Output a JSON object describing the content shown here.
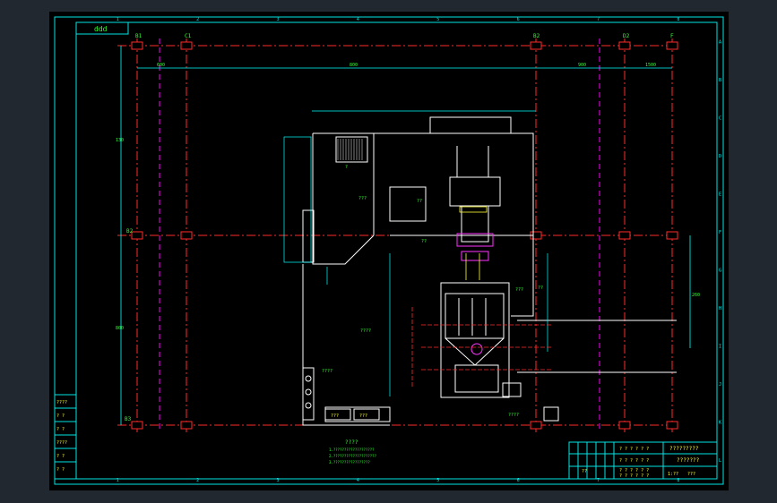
{
  "drawing": {
    "top_tag": "ddd",
    "column_markers": [
      "1",
      "2",
      "3",
      "4",
      "5",
      "6",
      "7",
      "8"
    ],
    "row_markers": [
      "A",
      "B",
      "C",
      "D",
      "E",
      "F",
      "G",
      "H",
      "I",
      "J",
      "K",
      "L"
    ],
    "axis_labels_top": [
      "B1",
      "C1",
      "B2",
      "D2",
      "F"
    ],
    "axis_label_mid_left": "B2",
    "axis_label_bottom_left": "B3",
    "dim_top": [
      "600",
      "800",
      "900",
      "1500"
    ],
    "dim_left": [
      "130",
      "800"
    ],
    "dim_right": "260",
    "area_labels": [
      "???",
      "??",
      "????",
      "??",
      "?",
      "??",
      "???",
      "????"
    ],
    "room_labels": [
      "??",
      "??",
      "???",
      "?"
    ],
    "bottom_boxes": [
      "???",
      "???"
    ],
    "small_note": "????",
    "notes_title": "????",
    "notes_lines": [
      "1.???????????????????",
      "2.????????????????????",
      "3.?????????????????"
    ]
  },
  "left_table": {
    "rows": [
      "????",
      "? ?",
      "? ?",
      "????",
      "? ?",
      "? ?"
    ]
  },
  "title_block": {
    "project": "?????????",
    "drawing_title": "???????",
    "cells": [
      "? ? ? ? ? ?",
      "? ? ? ? ? ?",
      "? ? ? ? ? ?",
      "? ? ? ? ? ?"
    ],
    "sign": "??",
    "scale": "1:??",
    "sheet": "???"
  },
  "colors": {
    "frame": "#00e5e5",
    "axis": "#ff2a2a",
    "pink_axis": "#ff00ff",
    "wall": "#ffffff",
    "dim": "#00ffff",
    "green": "#33ff33",
    "yellow": "#ffff33",
    "magenta": "#ff33ff"
  }
}
